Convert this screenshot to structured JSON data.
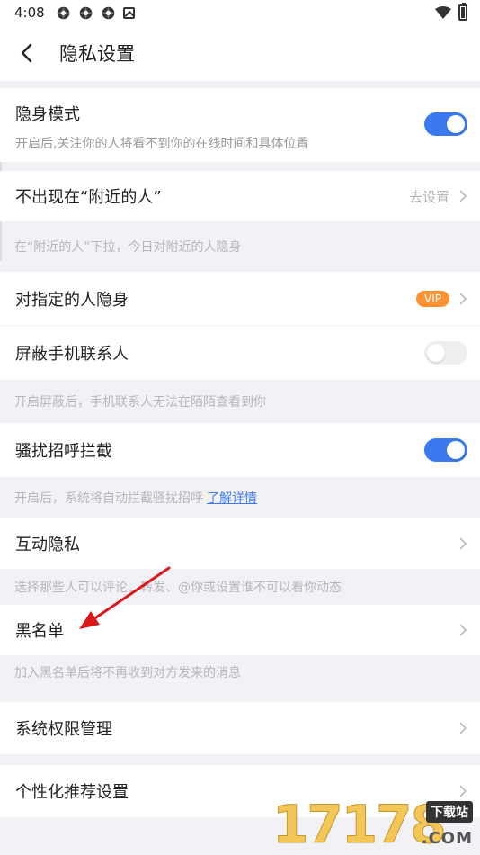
{
  "status": {
    "time": "4:08"
  },
  "header": {
    "title": "隐私设置"
  },
  "invisible_mode": {
    "title": "隐身模式",
    "subtitle": "开启后,关注你的人将看不到你的在线时间和具体位置",
    "enabled": true
  },
  "nearby": {
    "title": "不出现在“附近的人”",
    "action": "去设置",
    "note": "在“附近的人”下拉，今日对附近的人隐身"
  },
  "hide_from_specific": {
    "title": "对指定的人隐身",
    "badge": "VIP"
  },
  "block_contacts": {
    "title": "屏蔽手机联系人",
    "enabled": false,
    "note": "开启屏蔽后，手机联系人无法在陌陌查看到你"
  },
  "harassment": {
    "title": "骚扰招呼拦截",
    "enabled": true,
    "note": "开启后，系统将自动拦截骚扰招呼",
    "link": "了解详情"
  },
  "interaction_privacy": {
    "title": "互动隐私",
    "note": "选择那些人可以评论、转发、@你或设置谁不可以看你动态"
  },
  "blacklist": {
    "title": "黑名单",
    "note": "加入黑名单后将不再收到对方发来的消息"
  },
  "system_permissions": {
    "title": "系统权限管理"
  },
  "personalized": {
    "title": "个性化推荐设置"
  },
  "watermark": {
    "digits": "17178",
    "top": "下载站",
    "bottom": ".COM"
  },
  "colors": {
    "accent": "#3a79f0",
    "vip": "#ff9333",
    "arrow": "#d9191c"
  }
}
